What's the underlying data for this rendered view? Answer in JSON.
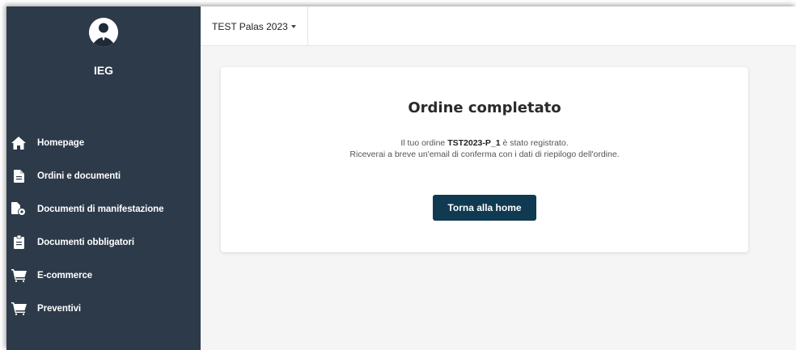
{
  "sidebar": {
    "org_name": "IEG",
    "items": [
      {
        "label": "Homepage",
        "icon": "home-icon"
      },
      {
        "label": "Ordini e documenti",
        "icon": "document-icon"
      },
      {
        "label": "Documenti di manifestazione",
        "icon": "documents-settings-icon"
      },
      {
        "label": "Documenti obbligatori",
        "icon": "clipboard-icon"
      },
      {
        "label": "E-commerce",
        "icon": "cart-icon"
      },
      {
        "label": "Preventivi",
        "icon": "cart-icon"
      }
    ]
  },
  "topbar": {
    "event_selector": "TEST Palas 2023"
  },
  "card": {
    "title": "Ordine completato",
    "message_prefix": "Il tuo ordine",
    "order_code": "TST2023-P_1",
    "message_suffix": "è stato registrato.",
    "message_line2": "Riceverai a breve un'email di conferma con i dati di riepilogo dell'ordine.",
    "button_label": "Torna alla home"
  },
  "colors": {
    "sidebar_bg": "#2d3a4a",
    "button_bg": "#0f3a52",
    "page_bg": "#f5f5f5"
  }
}
